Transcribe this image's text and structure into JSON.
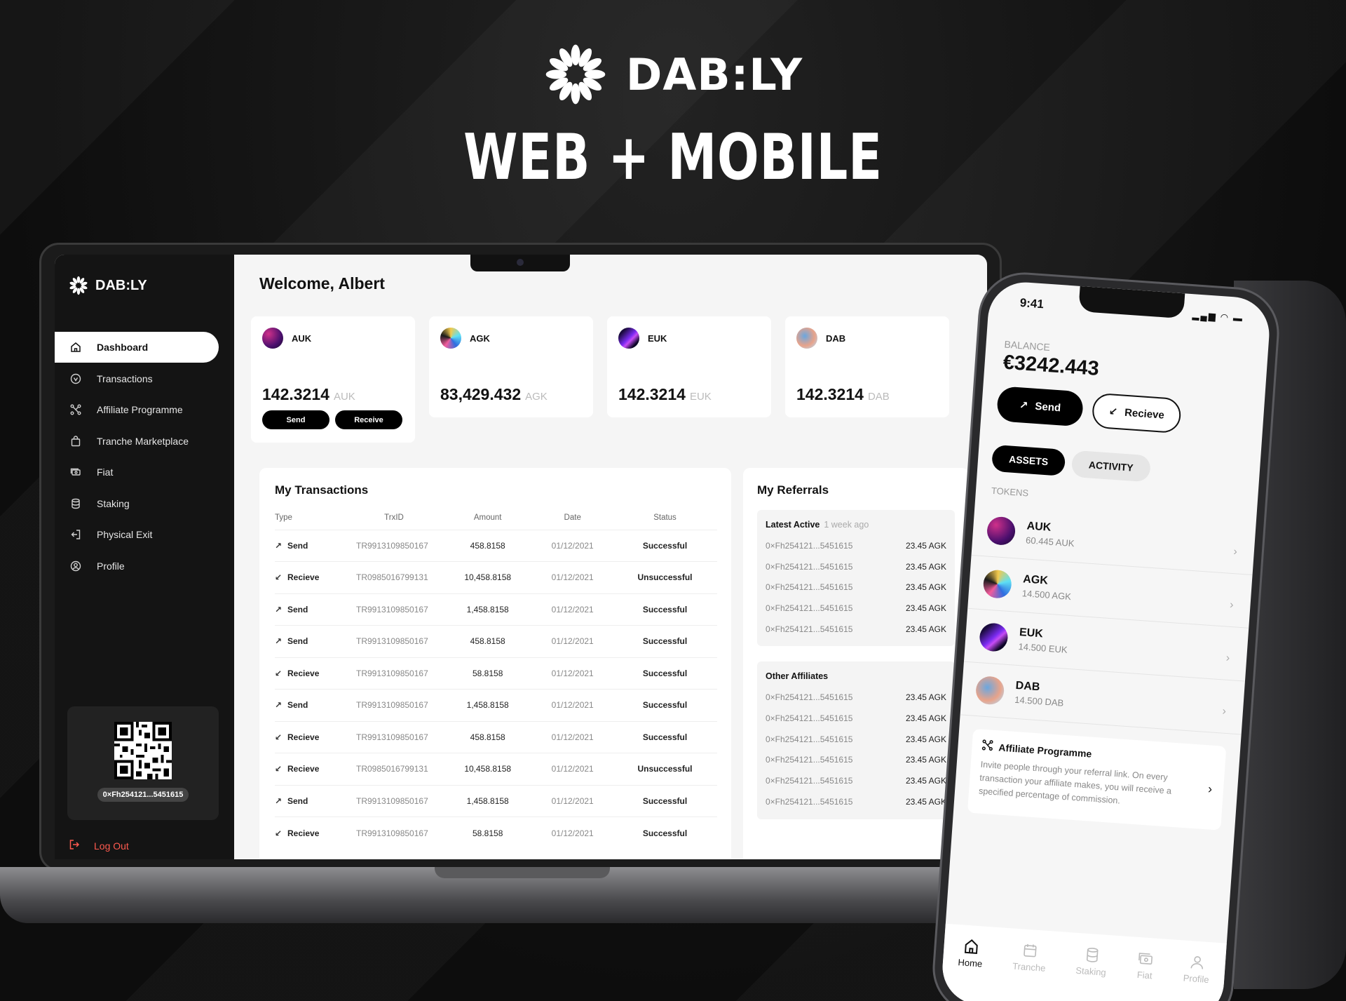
{
  "hero": {
    "brand": "DAB:LY",
    "title": "WEB + MOBILE"
  },
  "colors": {
    "success": "#1fbf8f",
    "error": "#e0443a",
    "logout": "#ff5a4f"
  },
  "web": {
    "brand": "DAB:LY",
    "welcome": "Welcome, Albert",
    "nav": [
      {
        "label": "Dashboard",
        "icon": "home-icon",
        "active": true
      },
      {
        "label": "Transactions",
        "icon": "transactions-icon"
      },
      {
        "label": "Affiliate Programme",
        "icon": "affiliate-icon"
      },
      {
        "label": "Tranche Marketplace",
        "icon": "bag-icon"
      },
      {
        "label": "Fiat",
        "icon": "cash-icon"
      },
      {
        "label": "Staking",
        "icon": "database-icon"
      },
      {
        "label": "Physical Exit",
        "icon": "exit-icon"
      },
      {
        "label": "Profile",
        "icon": "user-circle-icon"
      }
    ],
    "wallet_address": "0×Fh254121...5451615",
    "logout": "Log Out",
    "tokens": [
      {
        "name": "AUK",
        "balance": "142.3214",
        "unit": "AUK",
        "send": "Send",
        "receive": "Receive"
      },
      {
        "name": "AGK",
        "balance": "83,429.432",
        "unit": "AGK"
      },
      {
        "name": "EUK",
        "balance": "142.3214",
        "unit": "EUK"
      },
      {
        "name": "DAB",
        "balance": "142.3214",
        "unit": "DAB"
      }
    ],
    "transactions": {
      "title": "My Transactions",
      "headers": [
        "Type",
        "TrxID",
        "Amount",
        "Date",
        "Status"
      ],
      "rows": [
        {
          "type": "Send",
          "id": "TR9913109850167",
          "amount": "458.8158",
          "date": "01/12/2021",
          "status": "Successful",
          "ok": true
        },
        {
          "type": "Recieve",
          "id": "TR0985016799131",
          "amount": "10,458.8158",
          "date": "01/12/2021",
          "status": "Unsuccessful",
          "ok": false
        },
        {
          "type": "Send",
          "id": "TR9913109850167",
          "amount": "1,458.8158",
          "date": "01/12/2021",
          "status": "Successful",
          "ok": true
        },
        {
          "type": "Send",
          "id": "TR9913109850167",
          "amount": "458.8158",
          "date": "01/12/2021",
          "status": "Successful",
          "ok": true
        },
        {
          "type": "Recieve",
          "id": "TR9913109850167",
          "amount": "58.8158",
          "date": "01/12/2021",
          "status": "Successful",
          "ok": true
        },
        {
          "type": "Send",
          "id": "TR9913109850167",
          "amount": "1,458.8158",
          "date": "01/12/2021",
          "status": "Successful",
          "ok": true
        },
        {
          "type": "Recieve",
          "id": "TR9913109850167",
          "amount": "458.8158",
          "date": "01/12/2021",
          "status": "Successful",
          "ok": true
        },
        {
          "type": "Recieve",
          "id": "TR0985016799131",
          "amount": "10,458.8158",
          "date": "01/12/2021",
          "status": "Unsuccessful",
          "ok": false
        },
        {
          "type": "Send",
          "id": "TR9913109850167",
          "amount": "1,458.8158",
          "date": "01/12/2021",
          "status": "Successful",
          "ok": true
        },
        {
          "type": "Recieve",
          "id": "TR9913109850167",
          "amount": "58.8158",
          "date": "01/12/2021",
          "status": "Successful",
          "ok": true
        }
      ]
    },
    "referrals": {
      "title": "My Referrals",
      "latest_label": "Latest Active",
      "latest_time": "1 week ago",
      "latest": [
        {
          "addr": "0×Fh254121...5451615",
          "value": "23.45 AGK"
        },
        {
          "addr": "0×Fh254121...5451615",
          "value": "23.45 AGK"
        },
        {
          "addr": "0×Fh254121...5451615",
          "value": "23.45 AGK"
        },
        {
          "addr": "0×Fh254121...5451615",
          "value": "23.45 AGK"
        },
        {
          "addr": "0×Fh254121...5451615",
          "value": "23.45 AGK"
        }
      ],
      "other_label": "Other Affiliates",
      "other": [
        {
          "addr": "0×Fh254121...5451615",
          "value": "23.45 AGK"
        },
        {
          "addr": "0×Fh254121...5451615",
          "value": "23.45 AGK"
        },
        {
          "addr": "0×Fh254121...5451615",
          "value": "23.45 AGK"
        },
        {
          "addr": "0×Fh254121...5451615",
          "value": "23.45 AGK"
        },
        {
          "addr": "0×Fh254121...5451615",
          "value": "23.45 AGK"
        },
        {
          "addr": "0×Fh254121...5451615",
          "value": "23.45 AGK"
        }
      ]
    }
  },
  "mobile": {
    "time": "9:41",
    "balance_label": "BALANCE",
    "balance": "€3242.443",
    "send": "Send",
    "receive": "Recieve",
    "tabs": [
      "ASSETS",
      "ACTIVITY"
    ],
    "tokens_label": "TOKENS",
    "tokens": [
      {
        "name": "AUK",
        "amount": "60.445 AUK"
      },
      {
        "name": "AGK",
        "amount": "14.500 AGK"
      },
      {
        "name": "EUK",
        "amount": "14.500 EUK"
      },
      {
        "name": "DAB",
        "amount": "14.500 DAB"
      }
    ],
    "affiliate_title": "Affiliate Programme",
    "affiliate_text": "Invite people through your referral link. On every transaction your affiliate makes, you will receive a specified percentage of commission.",
    "nav": [
      "Home",
      "Tranche",
      "Staking",
      "Fiat",
      "Profile"
    ]
  }
}
